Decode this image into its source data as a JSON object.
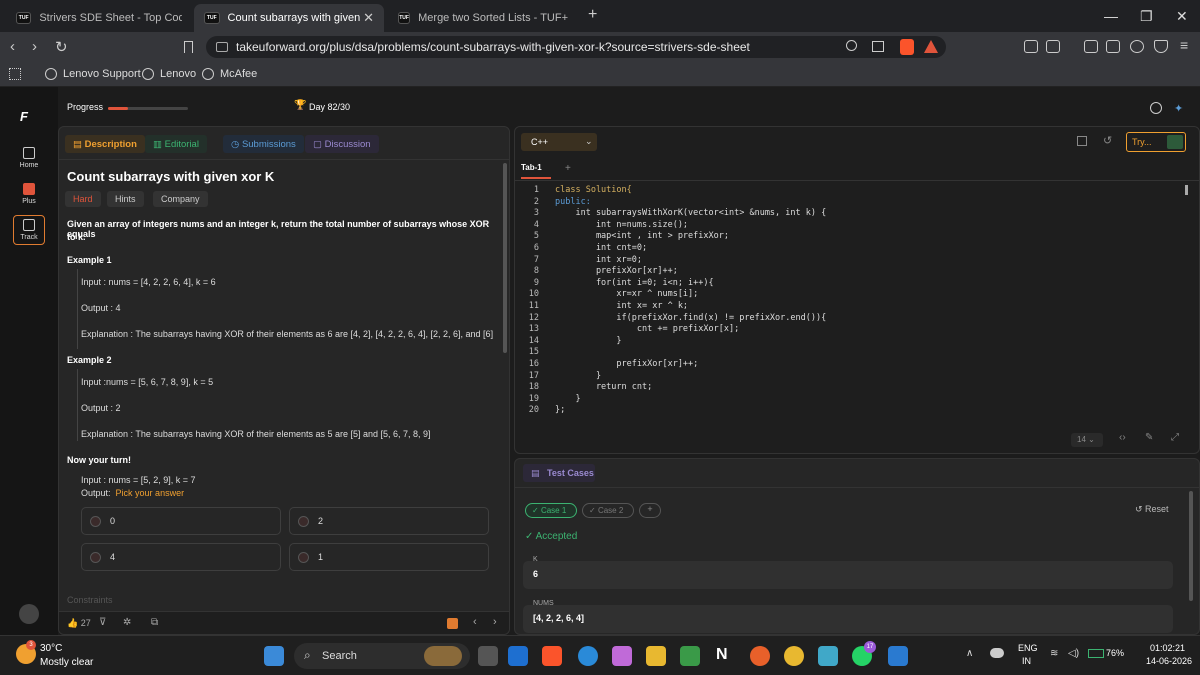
{
  "browser": {
    "tabs": [
      {
        "label": "Strivers SDE Sheet - Top Coding Inter",
        "favicon": "TUF"
      },
      {
        "label": "Count subarrays with given xor K",
        "favicon": "TUF"
      },
      {
        "label": "Merge two Sorted Lists - TUF+",
        "favicon": "TUF"
      }
    ],
    "new_tab": "+",
    "url": "takeuforward.org/plus/dsa/problems/count-subarrays-with-given-xor-k?source=strivers-sde-sheet",
    "bookmarks": [
      "Lenovo Support",
      "Lenovo",
      "McAfee"
    ]
  },
  "sidebar": {
    "home": "Home",
    "plus": "Plus",
    "track": "Track"
  },
  "topbar": {
    "progress_label": "Progress",
    "progress_fraction": 0.25,
    "day": "Day 82/30"
  },
  "problem": {
    "tabs": [
      "Description",
      "Editorial",
      "Submissions",
      "Discussion"
    ],
    "title": "Count subarrays with given xor K",
    "tags": [
      "Hard",
      "Hints",
      "Company"
    ],
    "statement_pre": "Given an array of integers nums and an integer k, return the total number of subarrays whose ",
    "statement_bold": "XOR",
    "statement_post": " equals",
    "statement_line2": "to k.",
    "example1": {
      "heading": "Example 1",
      "input": "Input : nums = [4, 2, 2, 6, 4], k = 6",
      "output": "Output : 4",
      "explanation": "Explanation : The subarrays having XOR of their elements as 6 are [4, 2],  [4, 2, 2, 6, 4], [2, 2, 6], and [6]"
    },
    "example2": {
      "heading": "Example 2",
      "input": "Input :nums = [5, 6, 7, 8, 9], k = 5",
      "output": "Output : 2",
      "explanation": "Explanation : The subarrays having XOR of their elements as 5 are [5] and [5, 6, 7, 8, 9]"
    },
    "your_turn": {
      "heading": "Now your turn!",
      "input": "Input : nums = [5, 2, 9], k = 7",
      "output_label": "Output:",
      "pick": "Pick your answer",
      "options": [
        "0",
        "2",
        "4",
        "1"
      ]
    },
    "constraints": "Constraints",
    "likes": "27"
  },
  "editor": {
    "language": "C++",
    "tab": "Tab-1",
    "try_label": "Try...",
    "font_size": "14",
    "lines": [
      "class Solution{",
      "public:",
      "    int subarraysWithXorK(vector<int> &nums, int k) {",
      "        int n=nums.size();",
      "        map<int , int > prefixXor;",
      "        int cnt=0;",
      "        int xr=0;",
      "        prefixXor[xr]++;",
      "        for(int i=0; i<n; i++){",
      "            xr=xr ^ nums[i];",
      "            int x= xr ^ k;",
      "            if(prefixXor.find(x) != prefixXor.end()){",
      "                cnt += prefixXor[x];",
      "            }",
      "",
      "            prefixXor[xr]++;",
      "        }",
      "        return cnt;",
      "    }",
      "};"
    ]
  },
  "tests": {
    "title": "Test Cases",
    "cases": [
      "Case 1",
      "Case 2"
    ],
    "add": "+",
    "reset": "Reset",
    "status": "Accepted",
    "k_label": "K",
    "k_value": "6",
    "nums_label": "NUMS",
    "nums_value": "[4, 2, 2, 6, 4]"
  },
  "taskbar": {
    "weather_temp": "30°C",
    "weather_desc": "Mostly clear",
    "weather_badge": "3",
    "search": "Search",
    "lang": "ENG",
    "lang2": "IN",
    "battery": "76%",
    "time": "01:02:21",
    "date": "14-06-2026",
    "whatsapp_badge": "17"
  },
  "colors": {
    "accent": "#f0a030",
    "hard": "#e0543b",
    "accepted": "#3cb371",
    "link": "#5b9bd5"
  }
}
